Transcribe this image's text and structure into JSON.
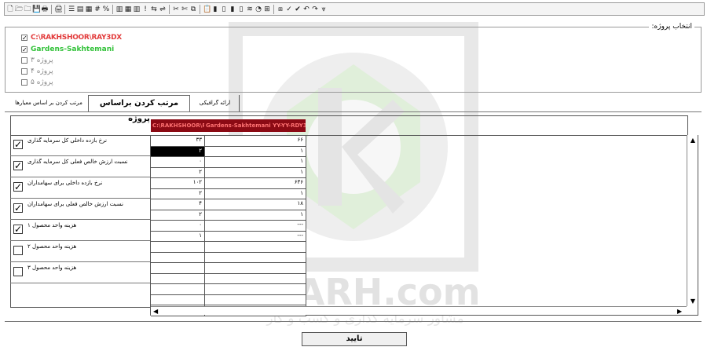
{
  "toolbar": {
    "icons": [
      "new-icon",
      "open-icon",
      "folder-icon",
      "save-icon",
      "print-icon",
      "print-preview-icon",
      "align-icon",
      "list-icon",
      "shapes-icon",
      "hash-icon",
      "percent-icon",
      "table-icon",
      "grid-icon",
      "columns-icon",
      "exclamation-icon",
      "link-icon",
      "transfer-icon",
      "cut-icon",
      "scissors-icon",
      "copy-icon",
      "paste-icon",
      "chart-icon",
      "bars-icon",
      "columns-chart-icon",
      "bar-chart-icon",
      "wave-icon",
      "pie-icon",
      "node-icon",
      "flow-icon",
      "check-icon",
      "check-alt-icon",
      "undo-icon",
      "redo-icon",
      "funnel-icon"
    ],
    "glyphs": [
      "🗋",
      "🗁",
      "🗀",
      "💾",
      "🖶",
      "🖨",
      "☰",
      "▤",
      "▦",
      "#",
      "%",
      "▥",
      "▦",
      "▥",
      "!",
      "⇆",
      "⇌",
      "✂",
      "✄",
      "⧉",
      "📋",
      "▮",
      "▯",
      "▮",
      "▯",
      "≋",
      "◔",
      "⊞",
      "⧈",
      "✓",
      "✔",
      "↶",
      "↷",
      "⩔"
    ]
  },
  "projects": {
    "title": "انتخاب پروژه:",
    "items": [
      {
        "label": "C:\\RAKHSHOOR\\RAY3DX",
        "checked": true,
        "style": "red"
      },
      {
        "label": "Gardens-Sakhtemani",
        "checked": true,
        "style": "green"
      },
      {
        "label": "پروژه ۳",
        "checked": false,
        "style": "grey"
      },
      {
        "label": "پروژه ۴",
        "checked": false,
        "style": "grey"
      },
      {
        "label": "پروژه ۵",
        "checked": false,
        "style": "grey"
      }
    ]
  },
  "tabs": {
    "graphic": "ارائه گرافیکی",
    "sort_by_project": "مرتب کردن براساس پروژه",
    "sort_by_criteria": "مرتب کردن بر اساس معیارها"
  },
  "grid": {
    "headers": [
      "C:\\RAKHSHOOR\\RAY3DX",
      "Gardens-Sakhtemani YY-YY-RDY3"
    ],
    "criteria": [
      {
        "label": "نرخ بازده داخلی کل سرمایه گذاری",
        "checked": true
      },
      {
        "label": "نسبت ارزش خالص فعلی کل سرمایه گذاری",
        "checked": true
      },
      {
        "label": "نرخ بازده داخلی برای سهامداران",
        "checked": true
      },
      {
        "label": "نسبت ارزش خالص فعلی برای سهامداران",
        "checked": true
      },
      {
        "label": "هزینه واحد محصول ۱",
        "checked": true
      },
      {
        "label": "هزینه واحد محصول ۲",
        "checked": false
      },
      {
        "label": "هزینه واحد محصول ۳",
        "checked": false
      }
    ],
    "rows": [
      [
        "۳۳",
        "۶۶"
      ],
      [
        "۲",
        "۱"
      ],
      [
        "۰",
        "۱"
      ],
      [
        "۲",
        "۱"
      ],
      [
        "۱۰۲",
        "۶۳۶"
      ],
      [
        "۲",
        "۱"
      ],
      [
        "۴",
        "۱۸"
      ],
      [
        "۲",
        "۱"
      ],
      [
        "۰",
        "---"
      ],
      [
        "۱",
        "---"
      ],
      [
        "",
        ""
      ],
      [
        "",
        ""
      ],
      [
        "",
        ""
      ],
      [
        "",
        ""
      ],
      [
        "",
        ""
      ],
      [
        "",
        ""
      ],
      [
        "",
        ""
      ]
    ],
    "selected_row": 1,
    "selected_col": 0
  },
  "watermark": {
    "brand": "ETARH.com",
    "tagline": "مشاور سرمایه گذاری و کسب و کار"
  },
  "ok_button": "تایید"
}
